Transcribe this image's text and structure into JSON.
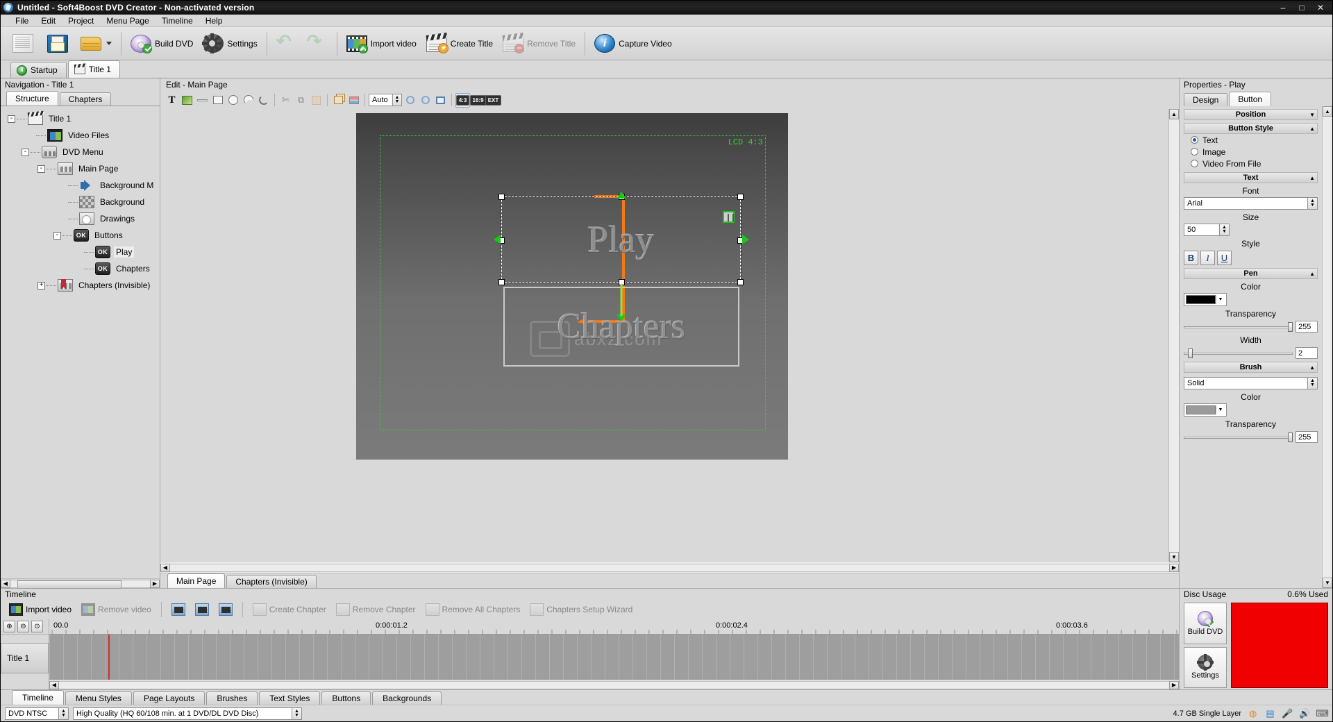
{
  "window": {
    "title": "Untitled - Soft4Boost DVD Creator - Non-activated version",
    "minimize": "–",
    "maximize": "□",
    "close": "✕"
  },
  "menubar": {
    "items": [
      "File",
      "Edit",
      "Project",
      "Menu Page",
      "Timeline",
      "Help"
    ]
  },
  "toolbar": {
    "new_label": "",
    "save_label": "",
    "open_label": "",
    "build_dvd": "Build DVD",
    "settings": "Settings",
    "undo": "",
    "redo": "",
    "import_video": "Import video",
    "create_title": "Create Title",
    "remove_title": "Remove Title",
    "capture_video": "Capture Video"
  },
  "doc_tabs": [
    {
      "label": "Startup",
      "icon": "power-icon",
      "active": false
    },
    {
      "label": "Title 1",
      "icon": "clapper-icon",
      "active": true
    }
  ],
  "navigation": {
    "caption": "Navigation - Title 1",
    "tabs": [
      {
        "label": "Structure",
        "active": true
      },
      {
        "label": "Chapters",
        "active": false
      }
    ],
    "tree": [
      {
        "label": "Title 1",
        "depth": 0,
        "toggle": "-",
        "icon": "title-icon",
        "selected": false
      },
      {
        "label": "Video Files",
        "depth": 1,
        "toggle": "",
        "icon": "video-files-icon",
        "selected": false
      },
      {
        "label": "DVD Menu",
        "depth": 1,
        "toggle": "-",
        "icon": "dvd-menu-icon",
        "selected": false
      },
      {
        "label": "Main Page",
        "depth": 2,
        "toggle": "-",
        "icon": "page-icon",
        "selected": false
      },
      {
        "label": "Background M",
        "depth": 3,
        "toggle": "",
        "icon": "speaker-icon",
        "selected": false
      },
      {
        "label": "Background",
        "depth": 3,
        "toggle": "",
        "icon": "background-icon",
        "selected": false
      },
      {
        "label": "Drawings",
        "depth": 3,
        "toggle": "",
        "icon": "drawings-icon",
        "selected": false
      },
      {
        "label": "Buttons",
        "depth": 3,
        "toggle": "-",
        "icon": "ok-icon",
        "selected": false
      },
      {
        "label": "Play",
        "depth": 4,
        "toggle": "",
        "icon": "ok-icon",
        "selected": true
      },
      {
        "label": "Chapters",
        "depth": 4,
        "toggle": "",
        "icon": "ok-icon",
        "selected": false
      },
      {
        "label": "Chapters (Invisible)",
        "depth": 2,
        "toggle": "+",
        "icon": "chapters-icon",
        "selected": false
      }
    ]
  },
  "editor": {
    "caption": "Edit - Main Page",
    "tools": [
      {
        "name": "text-tool",
        "glyph": "T"
      },
      {
        "name": "image-tool",
        "glyph": ""
      },
      {
        "name": "line-tool",
        "glyph": ""
      },
      {
        "name": "rectangle-tool",
        "glyph": ""
      },
      {
        "name": "ellipse-tool",
        "glyph": ""
      },
      {
        "name": "pie-tool",
        "glyph": ""
      },
      {
        "name": "arc-tool",
        "glyph": ""
      }
    ],
    "edit_tools": [
      {
        "name": "cut-button",
        "glyph": "✄",
        "disabled": true
      },
      {
        "name": "copy-button",
        "glyph": "⧉",
        "disabled": true
      },
      {
        "name": "paste-button",
        "glyph": "📋",
        "disabled": true
      }
    ],
    "arrange_tools": [
      {
        "name": "order-button",
        "glyph": "❐"
      },
      {
        "name": "align-button",
        "glyph": "≡"
      }
    ],
    "zoom_value": "Auto",
    "zoom_in": "＋",
    "zoom_out": "－",
    "fit_button": "⊡",
    "ratios": [
      {
        "label": "4:3",
        "active": true
      },
      {
        "label": "16:9",
        "active": false
      },
      {
        "label": "EXT",
        "active": false
      }
    ],
    "canvas": {
      "safe_area_label": "LCD 4:3",
      "watermark": "abxz.com",
      "buttons": [
        {
          "name": "play-button",
          "text": "Play",
          "selected": true
        },
        {
          "name": "chapters-button",
          "text": "Chapters",
          "selected": false
        }
      ]
    },
    "page_tabs": [
      {
        "label": "Main Page",
        "active": true
      },
      {
        "label": "Chapters (Invisible)",
        "active": false
      }
    ]
  },
  "properties": {
    "caption": "Properties - Play",
    "tabs": [
      {
        "label": "Design",
        "active": false
      },
      {
        "label": "Button",
        "active": true
      }
    ],
    "groups": {
      "position": {
        "title": "Position"
      },
      "button_style": {
        "title": "Button Style",
        "options": [
          {
            "label": "Text",
            "selected": true
          },
          {
            "label": "Image",
            "selected": false
          },
          {
            "label": "Video From File",
            "selected": false
          }
        ]
      },
      "text": {
        "title": "Text",
        "font_label": "Font",
        "font_value": "Arial",
        "size_label": "Size",
        "size_value": "50",
        "style_label": "Style",
        "style_buttons": [
          {
            "label": "B",
            "name": "bold-button"
          },
          {
            "label": "I",
            "name": "italic-button"
          },
          {
            "label": "U",
            "name": "underline-button"
          }
        ]
      },
      "pen": {
        "title": "Pen",
        "color_label": "Color",
        "color_value": "#000000",
        "transparency_label": "Transparency",
        "transparency_value": "255",
        "width_label": "Width",
        "width_value": "2"
      },
      "brush": {
        "title": "Brush",
        "fill_value": "Solid",
        "color_label": "Color",
        "color_value": "#9a9a9a",
        "transparency_label": "Transparency",
        "transparency_value": "255"
      }
    }
  },
  "timeline": {
    "caption": "Timeline",
    "buttons": [
      {
        "label": "Import video",
        "name": "import-video-button",
        "disabled": false,
        "icon": "film-icon"
      },
      {
        "label": "Remove video",
        "name": "remove-video-button",
        "disabled": true,
        "icon": "film-minus-icon"
      },
      {
        "label": "",
        "name": "split-video-button",
        "disabled": false,
        "icon": "split-icon"
      },
      {
        "label": "",
        "name": "trim-video-button",
        "disabled": false,
        "icon": "trim-icon"
      },
      {
        "label": "",
        "name": "effects-button",
        "disabled": false,
        "icon": "effects-icon"
      },
      {
        "label": "Create Chapter",
        "name": "create-chapter-button",
        "disabled": true,
        "icon": "chapter-plus-icon"
      },
      {
        "label": "Remove Chapter",
        "name": "remove-chapter-button",
        "disabled": true,
        "icon": "chapter-minus-icon"
      },
      {
        "label": "Remove All Chapters",
        "name": "remove-all-chapters-button",
        "disabled": true,
        "icon": "chapters-minus-icon"
      },
      {
        "label": "Chapters Setup Wizard",
        "name": "chapters-setup-wizard-button",
        "disabled": true,
        "icon": "wizard-icon"
      }
    ],
    "zoom_in": "🔍",
    "zoom_out": "🔍",
    "ruler_ticks": [
      "00.0",
      "0:00:01.2",
      "0:00:02.4",
      "0:00:03.6"
    ],
    "track_label": "Title 1"
  },
  "disc_usage": {
    "caption": "Disc Usage",
    "used": "0.6% Used",
    "build_label": "Build DVD",
    "settings_label": "Settings"
  },
  "bottom_tabs": [
    {
      "label": "Timeline",
      "active": true
    },
    {
      "label": "Menu Styles",
      "active": false
    },
    {
      "label": "Page Layouts",
      "active": false
    },
    {
      "label": "Brushes",
      "active": false
    },
    {
      "label": "Text Styles",
      "active": false
    },
    {
      "label": "Buttons",
      "active": false
    },
    {
      "label": "Backgrounds",
      "active": false
    }
  ],
  "statusbar": {
    "format": "DVD NTSC",
    "quality": "High Quality (HQ 60/108 min. at 1 DVD/DL DVD Disc)",
    "disc_info": "4.7 GB Single Layer",
    "tray_icons": [
      "disc-icon",
      "chart-icon",
      "mic-icon",
      "speaker-icon",
      "keyboard-icon"
    ]
  }
}
